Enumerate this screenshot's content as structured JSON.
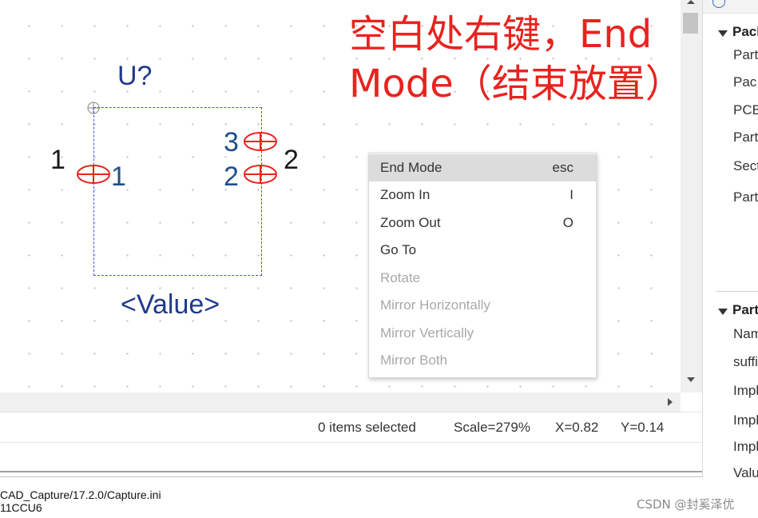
{
  "schematic": {
    "refdes": "U?",
    "value_label": "<Value>",
    "pins": [
      {
        "number": "1",
        "name": "1"
      },
      {
        "number": "2",
        "name": "2"
      },
      {
        "number": "3",
        "name": "3"
      }
    ]
  },
  "annotation": {
    "line1": "空白处右键，End",
    "line2": "Mode（结束放置）"
  },
  "context_menu": {
    "items": [
      {
        "label": "End Mode",
        "shortcut": "esc",
        "enabled": true,
        "highlighted": true
      },
      {
        "label": "Zoom In",
        "shortcut": "I",
        "enabled": true
      },
      {
        "label": "Zoom Out",
        "shortcut": "O",
        "enabled": true
      },
      {
        "label": "Go To",
        "shortcut": "",
        "enabled": true
      },
      {
        "label": "Rotate",
        "shortcut": "",
        "enabled": false
      },
      {
        "label": "Mirror Horizontally",
        "shortcut": "",
        "enabled": false
      },
      {
        "label": "Mirror Vertically",
        "shortcut": "",
        "enabled": false
      },
      {
        "label": "Mirror Both",
        "shortcut": "",
        "enabled": false
      }
    ]
  },
  "status": {
    "selection": "0 items selected",
    "scale": "Scale=279%",
    "x": "X=0.82",
    "y": "Y=0.14"
  },
  "session_log": {
    "line1": "CAD_Capture/17.2.0/Capture.ini",
    "line2": "11CCU6"
  },
  "watermark": "CSDN @封奚泽优",
  "property_panel": {
    "section1": {
      "title": "Pacl",
      "items": [
        "Part",
        "Pac",
        "PCB",
        "Part",
        "Sect",
        "Part"
      ]
    },
    "section2": {
      "title": "Part",
      "items": [
        "Nam",
        "suffi",
        "Impl",
        "Impl",
        "Impl",
        "Valu"
      ]
    }
  },
  "colors": {
    "annotation": "#e8231e",
    "pin_marker": "#e8231e",
    "part_outline": "#4b52d8",
    "refdes_text": "#1f3a8a"
  }
}
